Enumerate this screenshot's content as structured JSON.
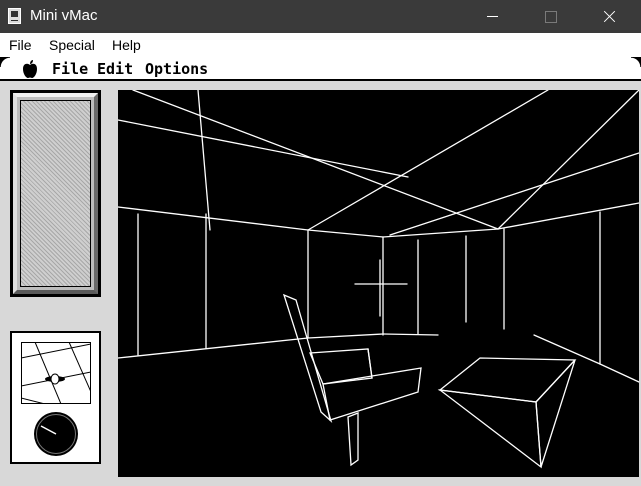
{
  "window": {
    "title": "Mini vMac",
    "app_icon": "mini-vmac-app-icon",
    "controls": [
      "minimize-icon",
      "maximize-icon",
      "close-icon"
    ]
  },
  "host_menu": {
    "items": [
      {
        "label": "File"
      },
      {
        "label": "Special"
      },
      {
        "label": "Help"
      }
    ]
  },
  "mac_menu": {
    "apple_icon": "apple-icon",
    "items": [
      {
        "label": "File"
      },
      {
        "label": "Edit"
      },
      {
        "label": "Options"
      }
    ]
  },
  "game": {
    "viewport": "3d-wireframe-room",
    "power_panel": "power-gauge",
    "map_panel": "overhead-map",
    "compass_panel": "compass-dial"
  },
  "colors": {
    "titlebar": "#3a3a3a",
    "viewport_bg": "#000000",
    "wireframe": "#ffffff"
  }
}
